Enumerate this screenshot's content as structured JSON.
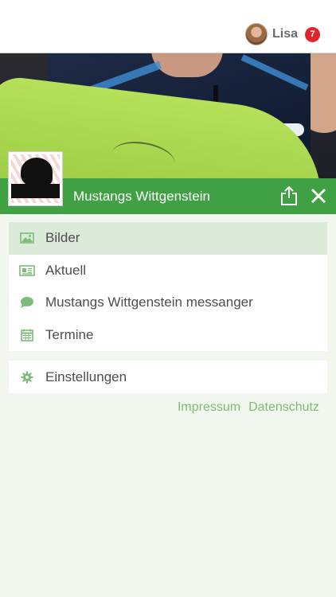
{
  "header": {
    "user_name": "Lisa",
    "notification_count": "7"
  },
  "club": {
    "title": "Mustangs Wittgenstein"
  },
  "menu": {
    "items": [
      {
        "label": "Bilder",
        "icon": "image-icon"
      },
      {
        "label": "Aktuell",
        "icon": "newspaper-icon"
      },
      {
        "label": "Mustangs Wittgenstein messanger",
        "icon": "chat-bubble-icon"
      },
      {
        "label": "Termine",
        "icon": "calendar-icon"
      }
    ],
    "settings_label": "Einstellungen"
  },
  "footer": {
    "impressum": "Impressum",
    "datenschutz": "Datenschutz"
  },
  "colors": {
    "brand_green": "#3fa143",
    "icon_green": "#7cbc78",
    "active_item_bg": "#dcebd9",
    "page_bg": "#f1f7ef",
    "badge_red": "#e0262c"
  }
}
